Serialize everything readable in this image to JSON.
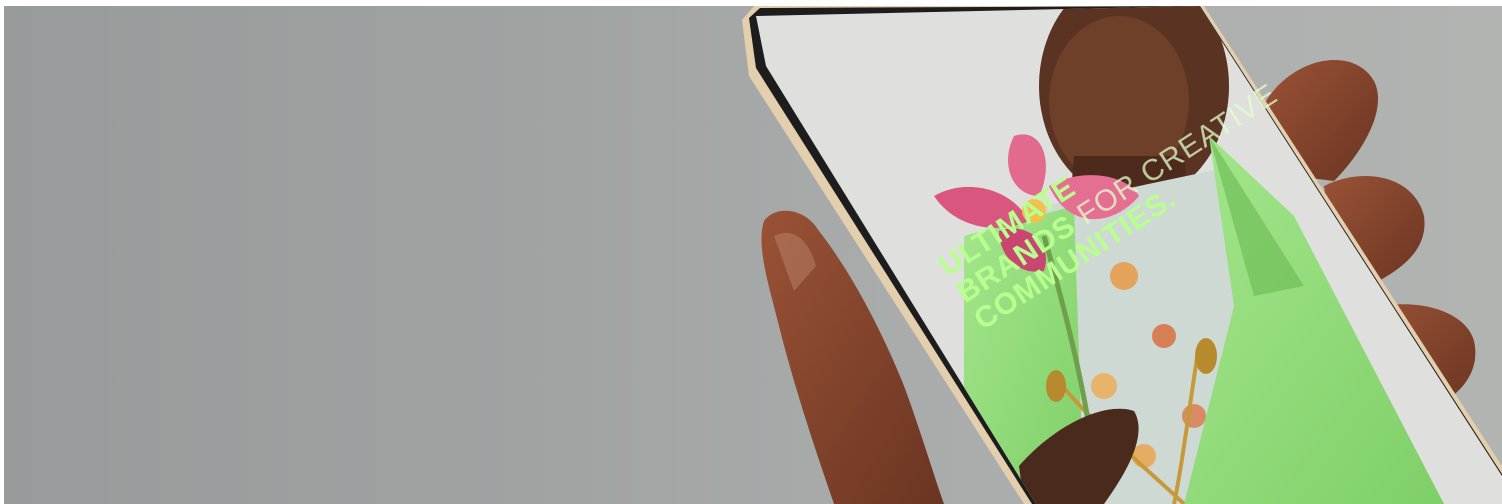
{
  "image": {
    "phone_screen": {
      "logo": "",
      "headline": {
        "line1": "ULTIMATE",
        "line2_bold": "BRANDS",
        "line2_thin": "FOR CREATIVE",
        "line3": "COMMUNITIES."
      }
    },
    "colors": {
      "background": "#9fa3a2",
      "accent_green": "#b9ff8f",
      "blazer_green": "#8ed772",
      "phone_frame": "#e3cfae",
      "skin": "#8a4a2e"
    }
  }
}
